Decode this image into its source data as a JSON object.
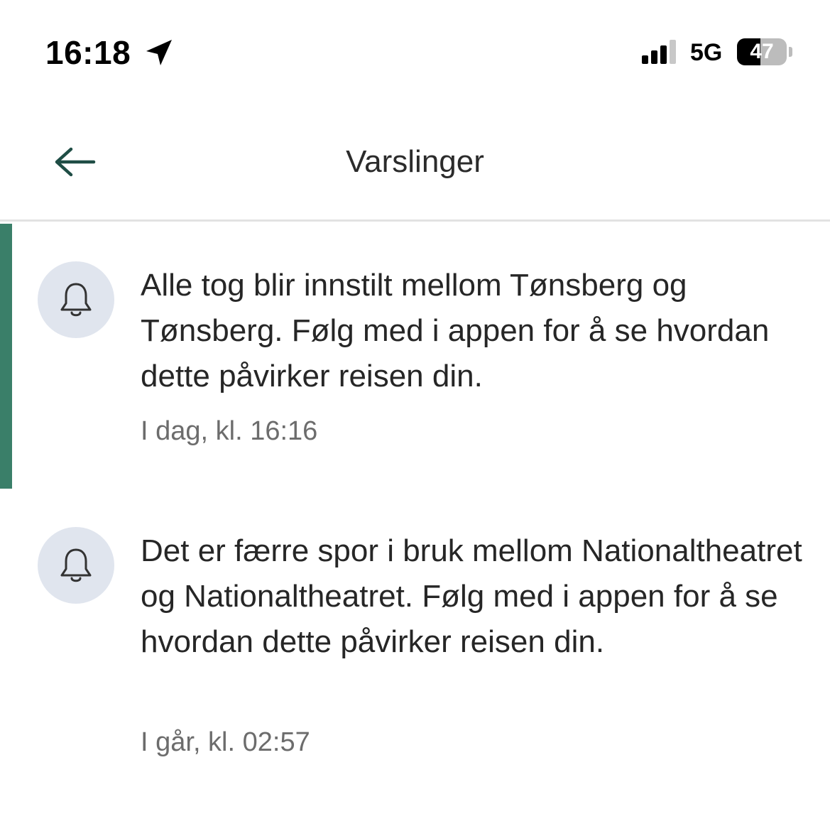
{
  "status_bar": {
    "time": "16:18",
    "network": "5G",
    "battery_percent": "47",
    "battery_level": 0.47,
    "icons": [
      "location-arrow-icon",
      "cellular-signal-icon",
      "battery-icon"
    ]
  },
  "header": {
    "title": "Varslinger",
    "back_icon": "arrow-left-icon",
    "accent_color": "#1f4d45"
  },
  "notifications": [
    {
      "text": "Alle tog blir innstilt mellom Tønsberg og Tønsberg. Følg med i appen for å se hvordan dette påvirker reisen din.",
      "time": "I dag, kl. 16:16",
      "unread": true,
      "icon": "bell-icon"
    },
    {
      "text": "Det er færre spor i bruk mellom Nationaltheatret og Nationaltheatret. Følg med i appen for å se hvordan dette påvirker reisen din.",
      "time": "I går, kl. 02:57",
      "unread": false,
      "icon": "bell-icon"
    }
  ],
  "colors": {
    "unread_indicator": "#3a7f69",
    "icon_badge_bg": "#e0e5ee",
    "timestamp": "#6c6c6c",
    "divider": "#e2e2e2"
  }
}
